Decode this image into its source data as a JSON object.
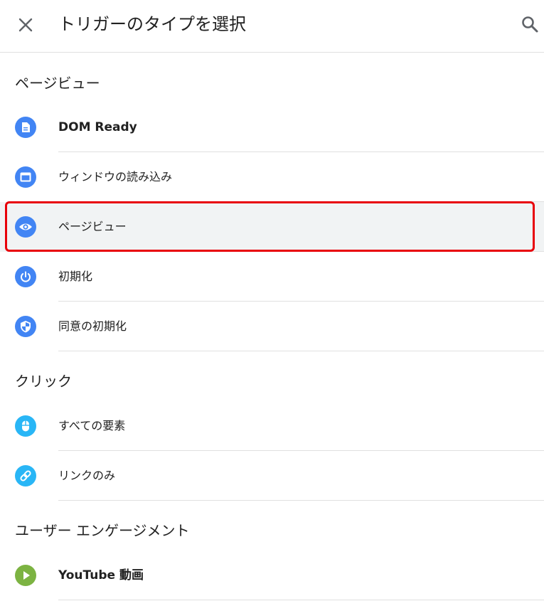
{
  "header": {
    "title": "トリガーのタイプを選択"
  },
  "icons": {
    "close": "close-icon",
    "search": "search-icon"
  },
  "colors": {
    "blue": "#4285f4",
    "lightblue": "#29b6f6",
    "green": "#7cb342",
    "selected_bg": "#f1f3f4",
    "highlight_border": "#e8000a"
  },
  "sections": [
    {
      "title": "ページビュー",
      "items": [
        {
          "label": "DOM Ready",
          "icon": "document-icon",
          "color": "#4285f4",
          "selected": false
        },
        {
          "label": "ウィンドウの読み込み",
          "icon": "window-icon",
          "color": "#4285f4",
          "selected": false
        },
        {
          "label": "ページビュー",
          "icon": "eye-icon",
          "color": "#4285f4",
          "selected": true
        },
        {
          "label": "初期化",
          "icon": "power-icon",
          "color": "#4285f4",
          "selected": false
        },
        {
          "label": "同意の初期化",
          "icon": "shield-icon",
          "color": "#4285f4",
          "selected": false
        }
      ]
    },
    {
      "title": "クリック",
      "items": [
        {
          "label": "すべての要素",
          "icon": "mouse-icon",
          "color": "#29b6f6",
          "selected": false
        },
        {
          "label": "リンクのみ",
          "icon": "link-icon",
          "color": "#29b6f6",
          "selected": false
        }
      ]
    },
    {
      "title": "ユーザー エンゲージメント",
      "items": [
        {
          "label": "YouTube 動画",
          "icon": "play-icon",
          "color": "#7cb342",
          "selected": false
        }
      ]
    }
  ]
}
